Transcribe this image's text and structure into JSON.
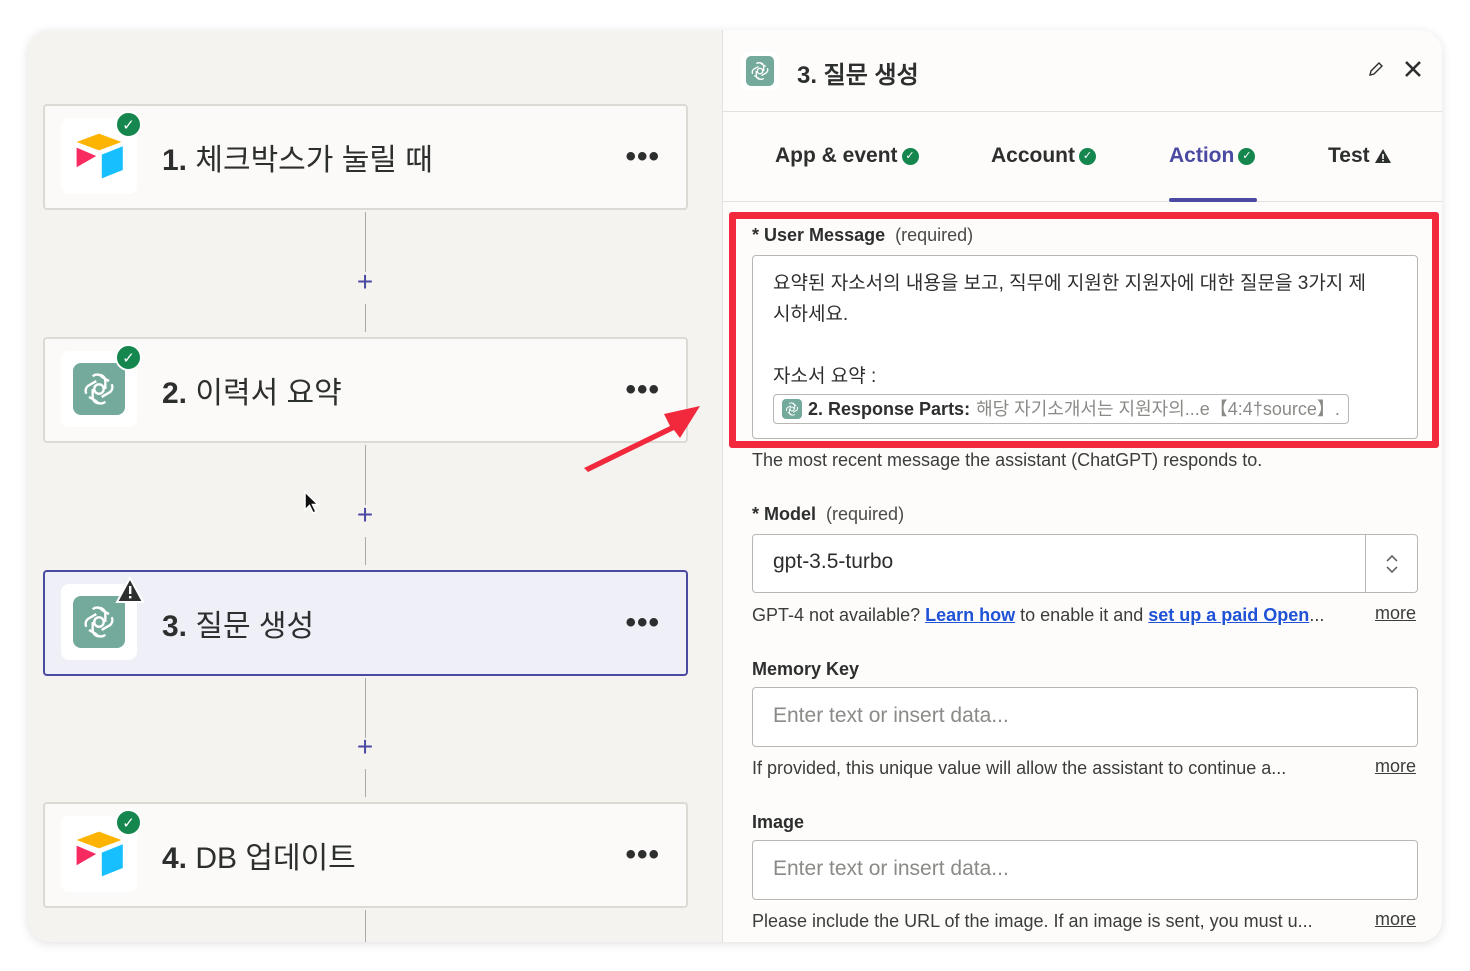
{
  "steps": [
    {
      "number": "1.",
      "title": "체크박스가 눌릴 때",
      "app": "airtable",
      "status": "complete"
    },
    {
      "number": "2.",
      "title": "이력서 요약",
      "app": "chatgpt",
      "status": "complete"
    },
    {
      "number": "3.",
      "title": "질문 생성",
      "app": "chatgpt",
      "status": "warning"
    },
    {
      "number": "4.",
      "title": "DB 업데이트",
      "app": "airtable",
      "status": "complete"
    }
  ],
  "more_menu_label": "•••",
  "add_label": "+",
  "panel": {
    "title": "3. 질문 생성",
    "tabs": [
      {
        "label": "App & event",
        "status": "complete"
      },
      {
        "label": "Account",
        "status": "complete"
      },
      {
        "label": "Action",
        "status": "complete"
      },
      {
        "label": "Test",
        "status": "warning"
      }
    ],
    "user_message": {
      "star": "*",
      "label": "User Message",
      "req": "(required)",
      "line1": "요약된 자소서의 내용을 보고, 직무에 지원한 지원자에 대한 질문을 3가지 제",
      "line2": "시하세요.",
      "line3": "자소서 요약 :",
      "pill_label": "2. Response Parts:",
      "pill_value": "해당 자기소개서는 지원자의...e【4:4†source】.",
      "help": "The most recent message the assistant (ChatGPT) responds to."
    },
    "model": {
      "star": "*",
      "label": "Model",
      "req": "(required)",
      "value": "gpt-3.5-turbo",
      "help_pre": "GPT-4 not available?",
      "link1": "Learn how",
      "help_mid": "to enable it and",
      "link2": "set up a paid Open",
      "ellipsis": "...",
      "more": "more"
    },
    "memory_key": {
      "label": "Memory Key",
      "placeholder": "Enter text or insert data...",
      "help": "If provided, this unique value will allow the assistant to continue a...",
      "more": "more"
    },
    "image": {
      "label": "Image",
      "placeholder": "Enter text or insert data...",
      "help": "Please include the URL of the image. If an image is sent, you must u...",
      "more": "more"
    }
  },
  "colors": {
    "accent": "#4b4aa3",
    "success": "#16864f",
    "highlight": "#f2283c",
    "link": "#1f52d6"
  }
}
